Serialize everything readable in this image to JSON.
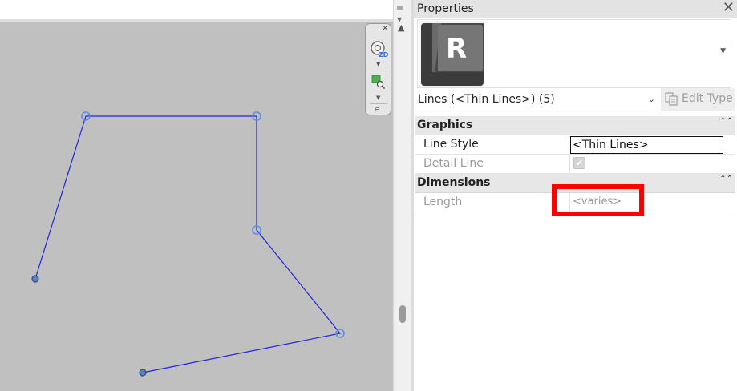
{
  "navigation_bar": {
    "view_mode_badge": "2D",
    "icons": [
      "close-icon",
      "steering-wheel-icon",
      "zoom-region-icon",
      "chevron-down-icon"
    ]
  },
  "properties_panel": {
    "title": "Properties",
    "type_selector": {
      "thumbnail_letter": "R"
    },
    "instance_filter": "Lines (<Thin Lines>) (5)",
    "edit_type_label": "Edit Type",
    "groups": [
      {
        "label": "Graphics",
        "rows": [
          {
            "name": "Line Style",
            "value": "<Thin Lines>"
          },
          {
            "name": "Detail Line",
            "checked": true
          }
        ]
      },
      {
        "label": "Dimensions",
        "rows": [
          {
            "name": "Length",
            "value": "<varies>"
          }
        ]
      }
    ]
  },
  "colors": {
    "canvas_background": "#c0c0c0",
    "sketch_line": "#2424d8",
    "grip": "#5a8ee0",
    "highlight": "#ff0000"
  }
}
